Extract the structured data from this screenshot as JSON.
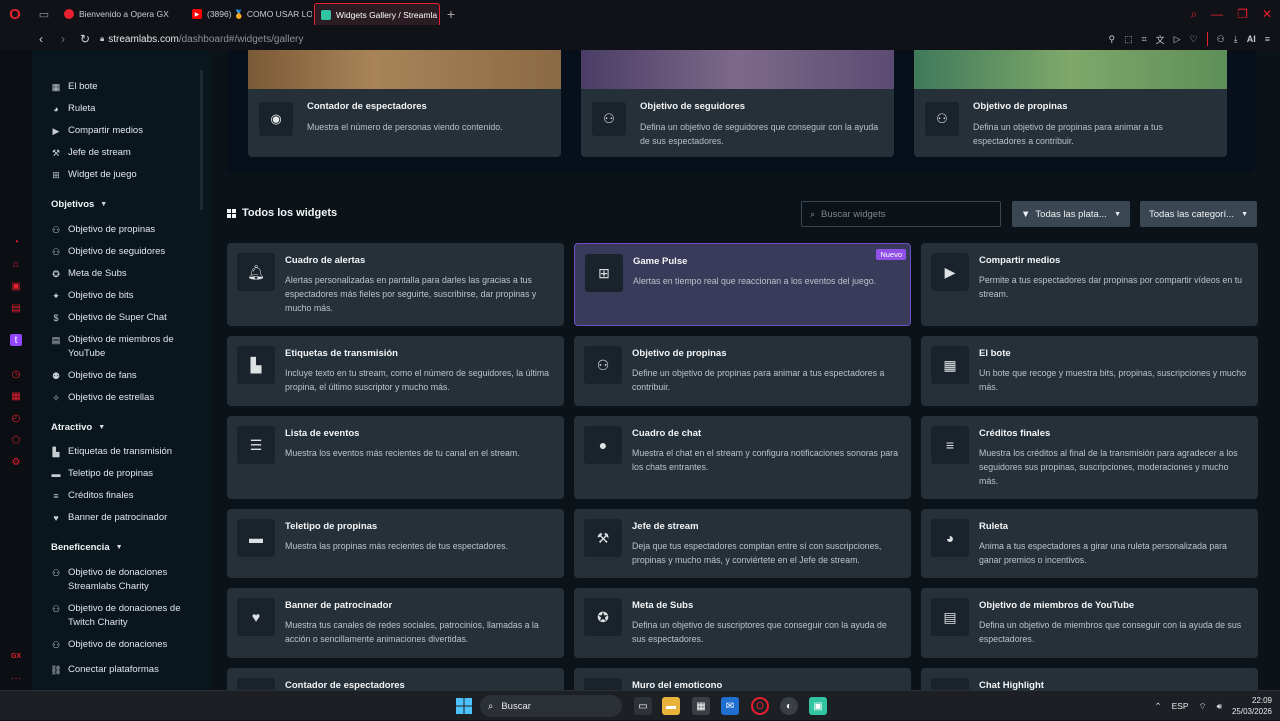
{
  "browser": {
    "tabs": [
      {
        "label": "Bienvenido a Opera GX",
        "favicon_color": "#e8202f"
      },
      {
        "label": "(3896) 🏅 COMO USAR LO",
        "favicon_color": "#ff0000"
      },
      {
        "label": "Widgets Gallery / Streamla",
        "favicon_color": "#31c3a2"
      }
    ],
    "url_host": "streamlabs.com",
    "url_path": "/dashboard#/widgets/gallery",
    "accent": "#e8202f",
    "ai_label": "AI"
  },
  "sidebar": {
    "top_items": [
      {
        "label": "El bote",
        "icon": "jar-icon"
      },
      {
        "label": "Ruleta",
        "icon": "wheel-icon"
      },
      {
        "label": "Compartir medios",
        "icon": "media-icon"
      },
      {
        "label": "Jefe de stream",
        "icon": "hammer-icon"
      },
      {
        "label": "Widget de juego",
        "icon": "gamepad-icon"
      }
    ],
    "sections": [
      {
        "title": "Objetivos",
        "items": [
          {
            "label": "Objetivo de propinas"
          },
          {
            "label": "Objetivo de seguidores"
          },
          {
            "label": "Meta de Subs"
          },
          {
            "label": "Objetivo de bits"
          },
          {
            "label": "Objetivo de Super Chat"
          },
          {
            "label": "Objetivo de miembros de YouTube"
          },
          {
            "label": "Objetivo de fans"
          },
          {
            "label": "Objetivo de estrellas"
          }
        ]
      },
      {
        "title": "Atractivo",
        "items": [
          {
            "label": "Etiquetas de transmisión"
          },
          {
            "label": "Teletipo de propinas"
          },
          {
            "label": "Créditos finales"
          },
          {
            "label": "Banner de patrocinador"
          }
        ]
      },
      {
        "title": "Beneficencia",
        "items": [
          {
            "label": "Objetivo de donaciones Streamlabs Charity"
          },
          {
            "label": "Objetivo de donaciones de Twitch Charity"
          },
          {
            "label": "Objetivo de donaciones"
          }
        ]
      }
    ],
    "connect_label": "Conectar plataformas"
  },
  "featured": [
    {
      "title": "Contador de espectadores",
      "desc": "Muestra el número de personas viendo contenido.",
      "icon": "eye-icon"
    },
    {
      "title": "Objetivo de seguidores",
      "desc": "Defina un objetivo de seguidores que conseguir con la ayuda de sus espectadores.",
      "icon": "user-plus-icon"
    },
    {
      "title": "Objetivo de propinas",
      "desc": "Defina un objetivo de propinas para animar a tus espectadores a contribuir.",
      "icon": "user-plus-icon"
    }
  ],
  "gallery": {
    "title": "Todos los widgets",
    "search_placeholder": "Buscar widgets",
    "platform_filter": "Todas las plata...",
    "category_filter": "Todas las categorí...",
    "new_badge": "Nuevo",
    "widgets": [
      {
        "title": "Cuadro de alertas",
        "desc": "Alertas personalizadas en pantalla para darles las gracias a tus espectadores más fieles por seguirte, suscribirse, dar propinas y mucho más.",
        "icon": "bell-icon"
      },
      {
        "title": "Game Pulse",
        "desc": "Alertas en tiempo real que reaccionan a los eventos del juego.",
        "icon": "gamepad-icon"
      },
      {
        "title": "Compartir medios",
        "desc": "Permite a tus espectadores dar propinas por compartir vídeos en tu stream.",
        "icon": "play-icon"
      },
      {
        "title": "Etiquetas de transmisión",
        "desc": "Incluye texto en tu stream, como el número de seguidores, la última propina, el último suscriptor y mucho más.",
        "icon": "file-icon"
      },
      {
        "title": "Objetivo de propinas",
        "desc": "Define un objetivo de propinas para animar a tus espectadores a contribuir.",
        "icon": "user-plus-icon"
      },
      {
        "title": "El bote",
        "desc": "Un bote que recoge y muestra bits, propinas, suscripciones y mucho más.",
        "icon": "jar-icon"
      },
      {
        "title": "Lista de eventos",
        "desc": "Muestra los eventos más recientes de tu canal en el stream.",
        "icon": "list-icon"
      },
      {
        "title": "Cuadro de chat",
        "desc": "Muestra el chat en el stream y configura notificaciones sonoras para los chats entrantes.",
        "icon": "chat-icon"
      },
      {
        "title": "Créditos finales",
        "desc": "Muestra los créditos al final de la transmisión para agradecer a los seguidores sus propinas, suscripciones, moderaciones y mucho más.",
        "icon": "align-icon"
      },
      {
        "title": "Teletipo de propinas",
        "desc": "Muestra las propinas más recientes de tus espectadores.",
        "icon": "ticker-icon"
      },
      {
        "title": "Jefe de stream",
        "desc": "Deja que tus espectadores compitan entre sí con suscripciones, propinas y mucho más, y conviértete en el Jefe de stream.",
        "icon": "hammer-icon"
      },
      {
        "title": "Ruleta",
        "desc": "Anima a tus espectadores a girar una ruleta personalizada para ganar premios o incentivos.",
        "icon": "pie-icon"
      },
      {
        "title": "Banner de patrocinador",
        "desc": "Muestra tus canales de redes sociales, patrocinios, llamadas a la acción o sencillamente animaciones divertidas.",
        "icon": "heart-icon"
      },
      {
        "title": "Meta de Subs",
        "desc": "Defina un objetivo de suscriptores que conseguir con la ayuda de sus espectadores.",
        "icon": "badge-icon"
      },
      {
        "title": "Objetivo de miembros de YouTube",
        "desc": "Defina un objetivo de miembros que conseguir con la ayuda de sus espectadores.",
        "icon": "member-icon"
      },
      {
        "title": "Contador de espectadores",
        "desc": "",
        "icon": "eye-icon"
      },
      {
        "title": "Muro del emoticono",
        "desc": "",
        "icon": "smile-icon"
      },
      {
        "title": "Chat Highlight",
        "desc": "",
        "icon": "chat-icon"
      }
    ]
  },
  "taskbar": {
    "search_label": "Buscar",
    "lang": "ESP",
    "time": "22:09",
    "date": "25/03/2026"
  }
}
